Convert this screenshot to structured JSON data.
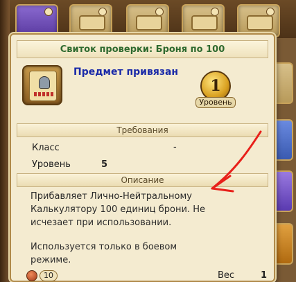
{
  "tooltip": {
    "title": "Свиток проверки: Броня по 100",
    "bound_text": "Предмет привязан",
    "level_number": "1",
    "level_label": "Уровень",
    "requirements_header": "Требования",
    "req_class_label": "Класс",
    "req_class_value": "-",
    "req_level_label": "Уровень",
    "req_level_value": "5",
    "description_header": "Описание",
    "description_line1": "Прибавляет Лично-Нейтральному",
    "description_line2": "Калькулятору 100 единиц брони. Не",
    "description_line3": "исчезает при использовании.",
    "description_line4": "Используется только в боевом",
    "description_line5": "режиме.",
    "price": "10",
    "weight_label": "Вес",
    "weight_value": "1"
  },
  "colors": {
    "title_green": "#2f6a2f",
    "bound_blue": "#1a2aa8",
    "annotation_red": "#e8201a"
  }
}
